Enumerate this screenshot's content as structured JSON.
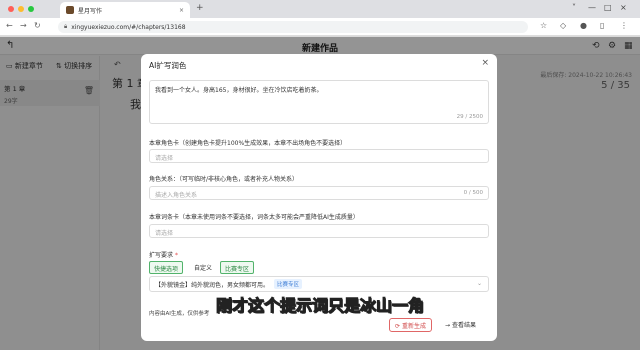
{
  "browser": {
    "tab_title": "星月写作",
    "tab_close": "×",
    "new_tab": "+",
    "url": "xingyuexiezuo.com/#/chapters/13168",
    "lock_icon": "lock-icon",
    "window_controls": [
      "˅",
      "—",
      "□",
      "×"
    ]
  },
  "app": {
    "page_title": "新建作品",
    "new_chapter_label": "新建章节",
    "switch_sort_label": "切换排序",
    "chapter": {
      "name": "第 1 章",
      "words": "29字"
    },
    "editor": {
      "chapter_title": "第 1 章",
      "body_text": "我",
      "saved_at": "最后保存: 2024-10-22 10:26:43",
      "count": "5 / 35"
    }
  },
  "modal": {
    "title": "AI扩写润色",
    "close": "×",
    "content": "我看到一个女人。身高165，身材很好。坐在冷饮店吃着奶茶。",
    "content_count": "29 / 2500",
    "role_card": {
      "label": "本章角色卡（创建角色卡提升100%生成效果，本章不出场角色不要选择）",
      "placeholder": "请选择"
    },
    "relation": {
      "label": "角色关系：（可写临时/非核心角色，或者补充人物关系）",
      "placeholder": "描述入角色关系",
      "count": "0 / 500"
    },
    "word_card": {
      "label": "本章词条卡（本章未使用词条不要选择，词条太多可能会严重降低AI生成质量）",
      "placeholder": "请选择"
    },
    "requirement": {
      "label": "扩写要求",
      "required_mark": "*",
      "options": [
        "快捷选项",
        "自定义",
        "比赛专区"
      ],
      "selected_text": "【外貌镜金】纯外貌润色，男女频都可用。",
      "selected_tag": "比赛专区"
    },
    "disclaimer": "内容由AI生成，仅供参考",
    "regen_label": "重新生成",
    "view_result_label": "查看结果"
  },
  "caption": "刚才这个提示词只是冰山一角",
  "colors": {
    "accent_green": "#52b36b",
    "danger_red": "#d14b4b",
    "tag_blue": "#3b7bd4"
  }
}
